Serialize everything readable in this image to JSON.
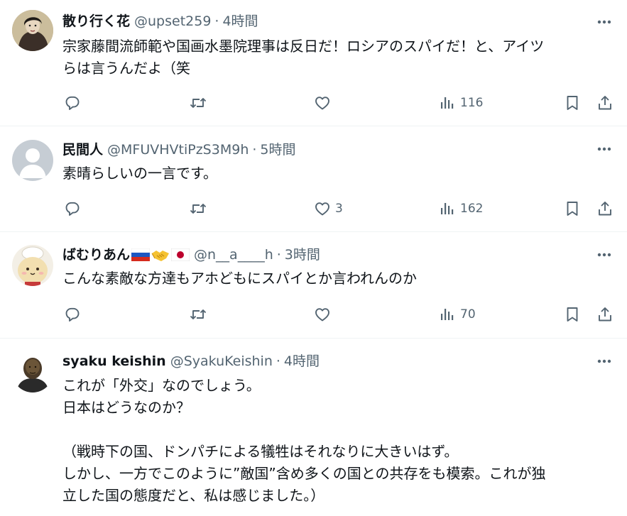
{
  "tweets": [
    {
      "display_name": "散り行く花",
      "handle": "@upset259",
      "separator": "·",
      "time": "4時間",
      "text": "宗家藤間流師範や国画水墨院理事は反日だ！ロシアのスパイだ！と、アイツ\nらは言うんだよ（笑",
      "reply_count": "",
      "retweet_count": "",
      "like_count": "",
      "view_count": "116"
    },
    {
      "display_name": "民間人",
      "handle": "@MFUVHVtiPzS3M9h",
      "separator": "·",
      "time": "5時間",
      "text": "素晴らしいの一言です。",
      "reply_count": "",
      "retweet_count": "",
      "like_count": "3",
      "view_count": "162"
    },
    {
      "display_name": "ばむりあん",
      "handle": "@n__a____h",
      "separator": "·",
      "time": "3時間",
      "text": "こんな素敵な方達もアホどもにスパイとか言われんのか",
      "reply_count": "",
      "retweet_count": "",
      "like_count": "",
      "view_count": "70"
    },
    {
      "display_name": "syaku keishin",
      "handle": "@SyakuKeishin",
      "separator": "·",
      "time": "4時間",
      "text": "これが「外交」なのでしょう。\n日本はどうなのか？\n\n（戦時下の国、ドンパチによる犠牲はそれなりに大きいはず。\nしかし、一方でこのように”敵国”含め多くの国との共存をも模索。これが独\n立した国の態度だと、私は感じました。）"
    }
  ],
  "colors": {
    "text_primary": "#0f1419",
    "text_secondary": "#536471",
    "divider": "#eff3f4"
  },
  "icons": {
    "more": "more-dots-icon",
    "reply": "reply-icon",
    "retweet": "retweet-icon",
    "like": "heart-icon",
    "views": "views-chart-icon",
    "bookmark": "bookmark-icon",
    "share": "share-icon",
    "flag_russia": "russia-flag-icon",
    "handshake": "handshake-icon",
    "flag_japan": "japan-flag-icon"
  }
}
